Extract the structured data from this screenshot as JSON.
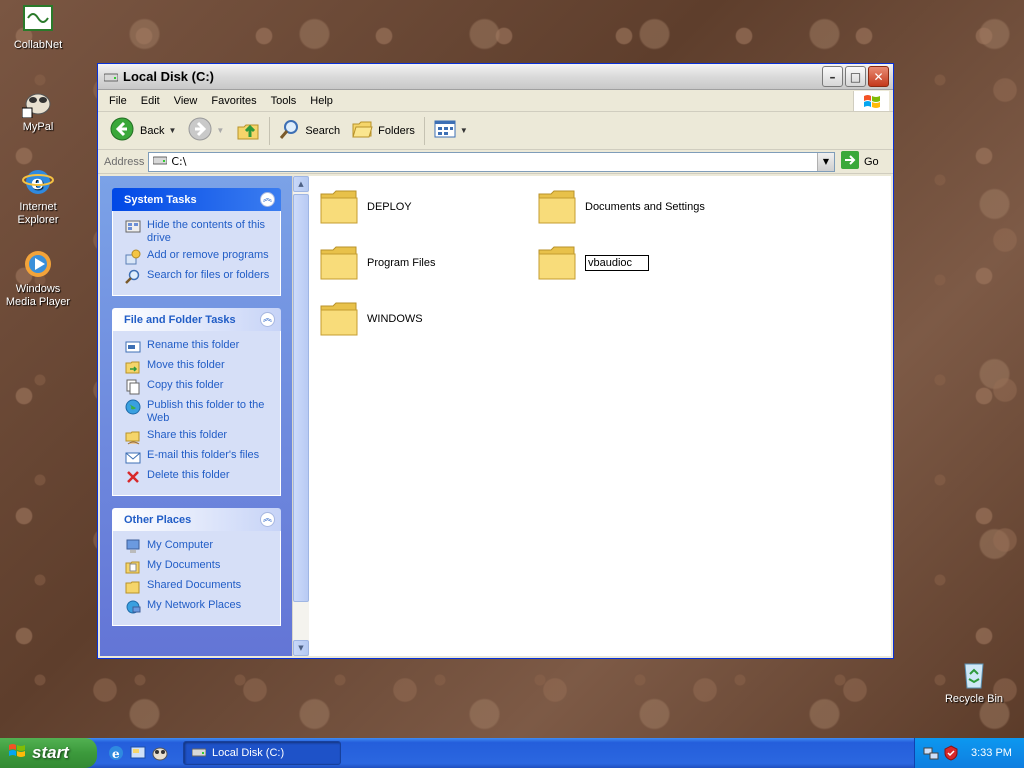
{
  "desktop": {
    "icons": [
      {
        "label": "CollabNet"
      },
      {
        "label": "MyPal"
      },
      {
        "label": "Internet Explorer"
      },
      {
        "label": "Windows Media Player"
      },
      {
        "label": "Recycle Bin"
      }
    ]
  },
  "window": {
    "title": "Local Disk (C:)",
    "menu": [
      "File",
      "Edit",
      "View",
      "Favorites",
      "Tools",
      "Help"
    ],
    "toolbar": {
      "back_label": "Back",
      "search_label": "Search",
      "folders_label": "Folders"
    },
    "address": {
      "label": "Address",
      "value": "C:\\",
      "go_label": "Go"
    },
    "taskpane": {
      "system_tasks": {
        "title": "System Tasks",
        "items": [
          "Hide the contents of this drive",
          "Add or remove programs",
          "Search for files or folders"
        ]
      },
      "file_folder_tasks": {
        "title": "File and Folder Tasks",
        "items": [
          "Rename this folder",
          "Move this folder",
          "Copy this folder",
          "Publish this folder to the Web",
          "Share this folder",
          "E-mail this folder's files",
          "Delete this folder"
        ]
      },
      "other_places": {
        "title": "Other Places",
        "items": [
          "My Computer",
          "My Documents",
          "Shared Documents",
          "My Network Places"
        ]
      }
    },
    "files": [
      {
        "name": "DEPLOY"
      },
      {
        "name": "Documents and Settings"
      },
      {
        "name": "Program Files"
      },
      {
        "name": "vbaudioc",
        "renaming": true
      },
      {
        "name": "WINDOWS"
      }
    ]
  },
  "taskbar": {
    "start_label": "start",
    "task_button_label": "Local Disk (C:)",
    "clock": "3:33 PM"
  },
  "colors": {
    "xp_blue": "#245edb",
    "start_green": "#3c9a3c",
    "task_link": "#215dc6",
    "folder_yellow": "#f5d56a"
  }
}
